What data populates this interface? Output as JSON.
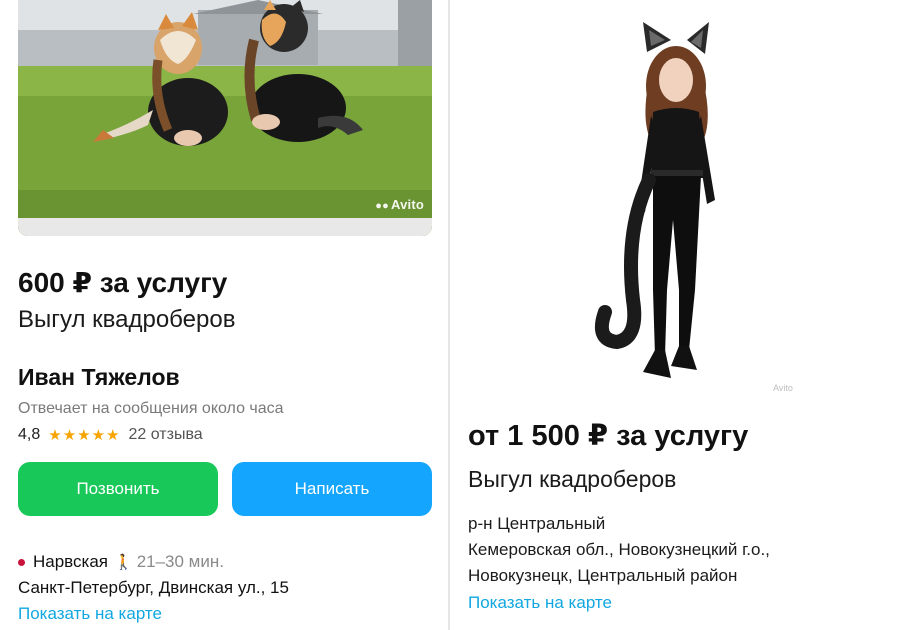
{
  "colors": {
    "call_button": "#18c858",
    "write_button": "#14a5ff",
    "link": "#11a7e0",
    "stars": "#f6a400",
    "metro_dot": "#c8143c"
  },
  "left_listing": {
    "photo_watermark": "Avito",
    "price": "600 ₽ за услугу",
    "title": "Выгул квадроберов",
    "seller": {
      "name": "Иван Тяжелов",
      "response_time": "Отвечает на сообщения около часа",
      "rating": "4,8",
      "stars": "★★★★★",
      "rating_stars_count": 5,
      "reviews": "22 отзыва"
    },
    "buttons": {
      "call": "Позвонить",
      "write": "Написать"
    },
    "location": {
      "metro": "Нарвская",
      "walk_icon": "pedestrian-icon",
      "walk_time": "21–30 мин.",
      "address": "Санкт-Петербург, Двинская ул., 15",
      "map_link": "Показать на карте"
    }
  },
  "right_listing": {
    "photo_watermark": "Avito",
    "price": "от 1 500 ₽ за услугу",
    "title": "Выгул квадроберов",
    "location": {
      "district": "р-н Центральный",
      "region": "Кемеровская обл., Новокузнецкий г.о.,",
      "city": "Новокузнецк, Центральный район",
      "map_link": "Показать на карте"
    }
  }
}
